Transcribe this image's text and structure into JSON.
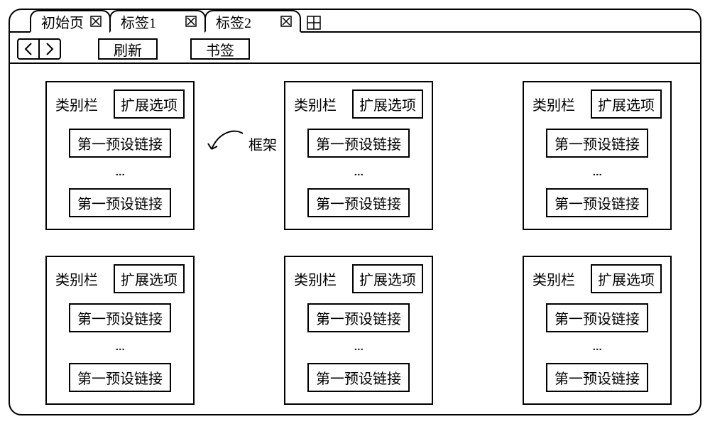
{
  "tabs": [
    {
      "label": "初始页"
    },
    {
      "label": "标签1"
    },
    {
      "label": "标签2"
    }
  ],
  "toolbar": {
    "refresh_label": "刷新",
    "bookmarks_label": "书签"
  },
  "card_template": {
    "category_label": "类别栏",
    "expand_label": "扩展选项",
    "link_label_top": "第一预设链接",
    "link_label_bottom": "第一预设链接",
    "dots": "⁝"
  },
  "callout": {
    "frame_label": "框架"
  },
  "cards": [
    0,
    1,
    2,
    3,
    4,
    5
  ]
}
